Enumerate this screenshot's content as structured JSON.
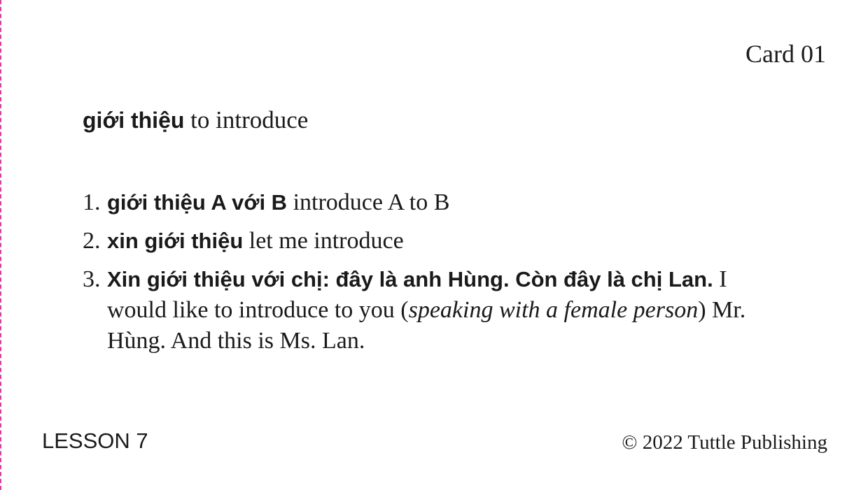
{
  "card": {
    "label": "Card 01",
    "headword": {
      "vietnamese": "giới thiệu",
      "english": "to introduce"
    },
    "examples": [
      {
        "number": "1.",
        "vietnamese": "giới thiệu A với B",
        "english": "introduce A to B"
      },
      {
        "number": "2.",
        "vietnamese": "xin giới thiệu",
        "english": "let me introduce"
      },
      {
        "number": "3.",
        "vietnamese": "Xin giới thiệu với chị: đây là anh Hùng. Còn đây là chị Lan.",
        "english_before": "I would like to introduce to you (",
        "english_italic": "speaking with a female person",
        "english_after": ") Mr. Hùng. And this is Ms. Lan."
      }
    ],
    "lesson": "LESSON 7",
    "copyright": "© 2022 Tuttle Publishing"
  },
  "colors": {
    "text": "#1a1a1a",
    "trim_line": "#d63fa0",
    "background": "#ffffff"
  }
}
